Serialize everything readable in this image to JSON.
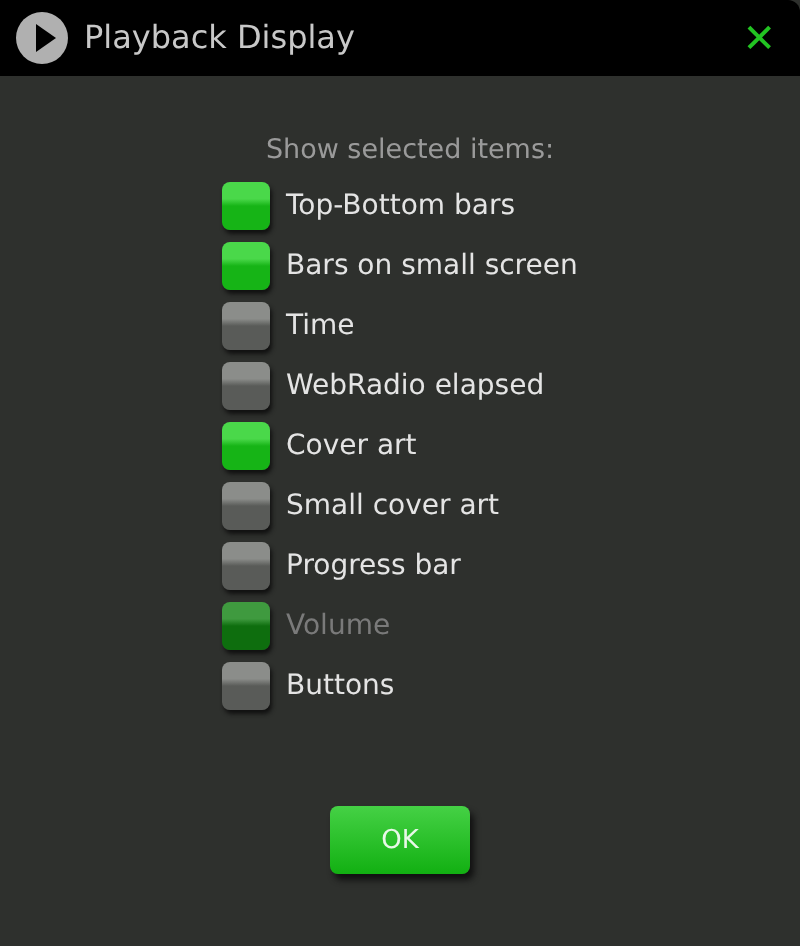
{
  "window": {
    "title": "Playback Display",
    "close": "✕"
  },
  "heading": "Show selected items:",
  "items": [
    {
      "label": "Top-Bottom bars",
      "checked": true,
      "disabled": false
    },
    {
      "label": "Bars on small screen",
      "checked": true,
      "disabled": false
    },
    {
      "label": "Time",
      "checked": false,
      "disabled": false
    },
    {
      "label": "WebRadio elapsed",
      "checked": false,
      "disabled": false
    },
    {
      "label": "Cover art",
      "checked": true,
      "disabled": false
    },
    {
      "label": "Small cover art",
      "checked": false,
      "disabled": false
    },
    {
      "label": "Progress bar",
      "checked": false,
      "disabled": false
    },
    {
      "label": "Volume",
      "checked": true,
      "disabled": true
    },
    {
      "label": "Buttons",
      "checked": false,
      "disabled": false
    }
  ],
  "buttons": [
    "OK"
  ]
}
